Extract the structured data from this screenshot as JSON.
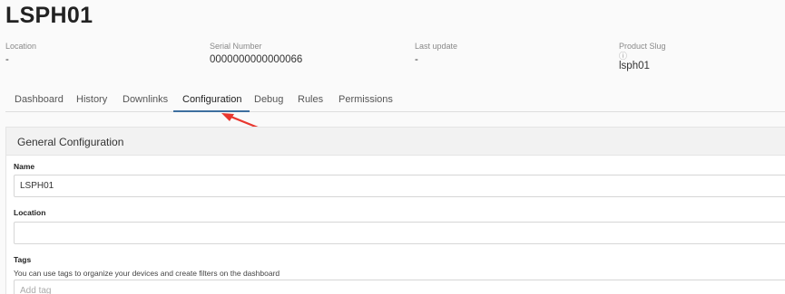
{
  "device": {
    "title": "LSPH01"
  },
  "meta": {
    "location": {
      "label": "Location",
      "value": "-"
    },
    "serial": {
      "label": "Serial Number",
      "value": "0000000000000066"
    },
    "last_update": {
      "label": "Last update",
      "value": "-"
    },
    "product_slug": {
      "label": "Product Slug",
      "hint": "ⓘ",
      "value": "lsph01"
    }
  },
  "tabs": [
    {
      "label": "Dashboard"
    },
    {
      "label": "History"
    },
    {
      "label": "Downlinks"
    },
    {
      "label": "Configuration",
      "active": true
    },
    {
      "label": "Debug"
    },
    {
      "label": "Rules"
    },
    {
      "label": "Permissions"
    }
  ],
  "colors": {
    "accent": "#3e6f9f",
    "annotation_arrow": "#e8372f"
  },
  "config": {
    "header": "General Configuration",
    "name": {
      "label": "Name",
      "value": "LSPH01"
    },
    "location": {
      "label": "Location",
      "value": ""
    },
    "tags": {
      "label": "Tags",
      "help": "You can use tags to organize your devices and create filters on the dashboard",
      "placeholder": "Add tag"
    }
  }
}
